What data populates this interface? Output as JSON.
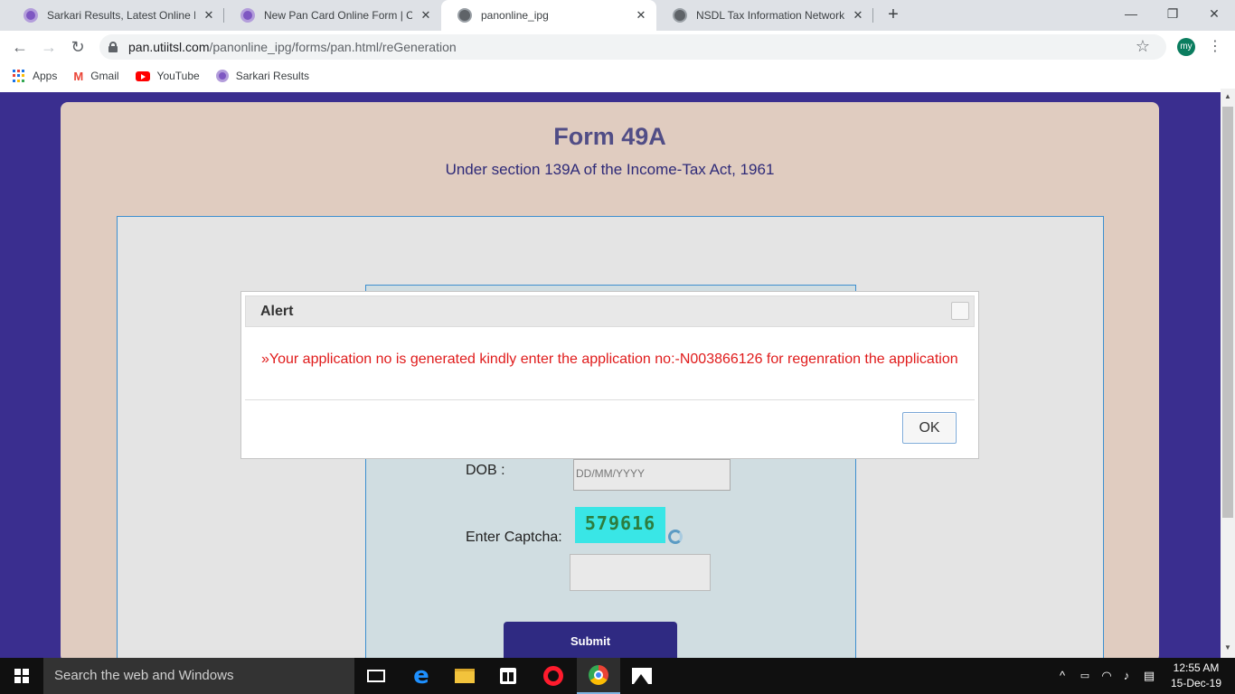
{
  "browser": {
    "tabs": [
      {
        "title": "Sarkari Results, Latest Online For",
        "icon": "sarkari-icon"
      },
      {
        "title": "New Pan Card Online Form | Corr",
        "icon": "sarkari-icon"
      },
      {
        "title": "panonline_ipg",
        "icon": "globe-icon"
      },
      {
        "title": "NSDL Tax Information Network (T",
        "icon": "globe-icon"
      }
    ],
    "new_tab": "+",
    "url_host": "pan.utiitsl.com",
    "url_path": "/panonline_ipg/forms/pan.html/reGeneration",
    "profile_initials": "my",
    "bookmarks": [
      {
        "label": "Apps",
        "icon": "apps-grid-icon"
      },
      {
        "label": "Gmail",
        "icon": "gmail-icon"
      },
      {
        "label": "YouTube",
        "icon": "youtube-icon"
      },
      {
        "label": "Sarkari Results",
        "icon": "sarkari-icon"
      }
    ]
  },
  "page": {
    "title": "Form 49A",
    "subtitle": "Under section 139A of the Income-Tax Act, 1961",
    "dob_label": "DOB :",
    "dob_placeholder": "DD/MM/YYYY",
    "captcha_label": "Enter Captcha:",
    "captcha_value": "579616",
    "submit_label": "Submit"
  },
  "alert": {
    "title": "Alert",
    "message": "»Your application no is generated kindly enter the application no:-N003866126 for regenration the application",
    "ok_label": "OK"
  },
  "taskbar": {
    "search_placeholder": "Search the web and Windows",
    "time": "12:55 AM",
    "date": "15-Dec-19"
  },
  "colors": {
    "page_background": "#3a2e8f",
    "card_background": "#e0ccc0",
    "alert_message": "#e01b1b",
    "submit_button": "#2f2a82"
  }
}
